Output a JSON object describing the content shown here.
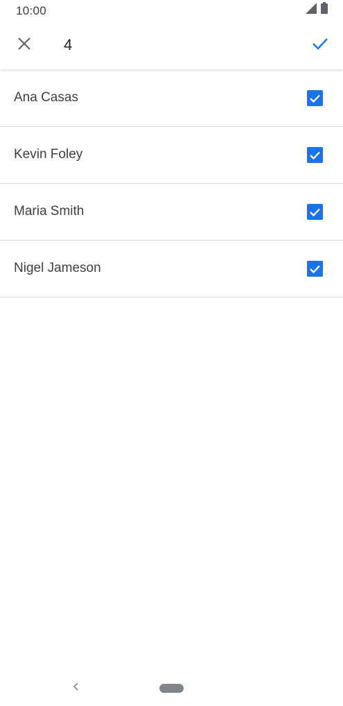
{
  "status_bar": {
    "time": "10:00",
    "icons": [
      "signal-icon",
      "battery-icon"
    ]
  },
  "app_bar": {
    "close_icon": "close-icon",
    "selected_count": "4",
    "confirm_icon": "check-icon"
  },
  "contacts": [
    {
      "name": "Ana Casas",
      "checked": true
    },
    {
      "name": "Kevin Foley",
      "checked": true
    },
    {
      "name": "Maria Smith",
      "checked": true
    },
    {
      "name": "Nigel Jameson",
      "checked": true
    }
  ],
  "nav_bar": {
    "back_icon": "back-chevron-icon",
    "home_icon": "home-pill-icon"
  },
  "colors": {
    "accent": "#1a73e8",
    "divider": "#dadce0",
    "text": "#3c4043"
  }
}
